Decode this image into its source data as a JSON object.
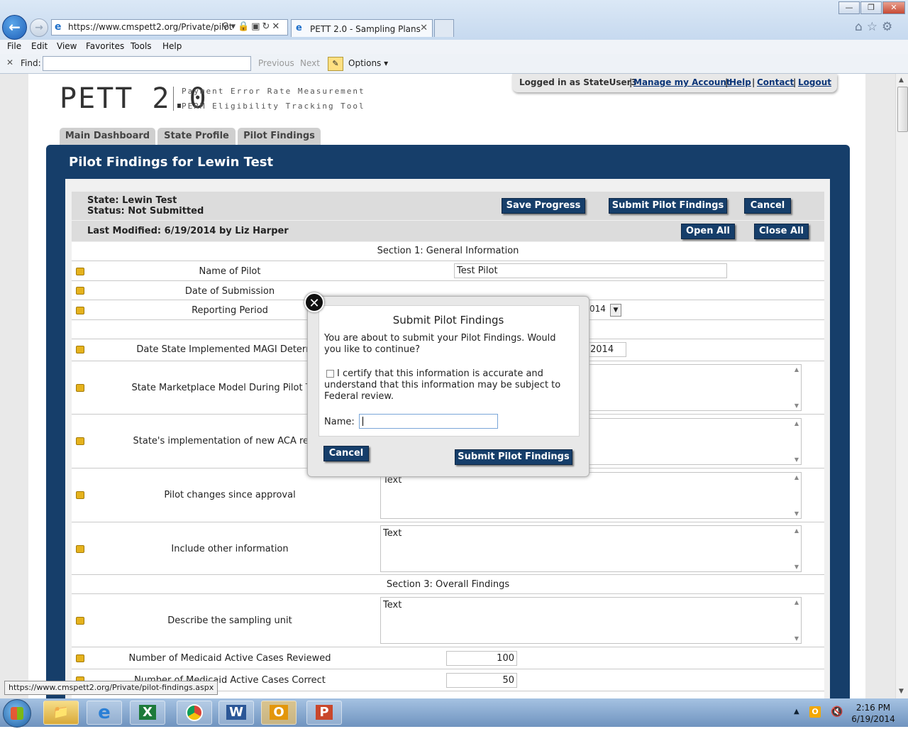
{
  "browser": {
    "url": "https://www.cmspett2.org/Private/pilot",
    "tab_title": "PETT 2.0 - Sampling Plans",
    "menu": [
      "File",
      "Edit",
      "View",
      "Favorites",
      "Tools",
      "Help"
    ],
    "find_label": "Find:",
    "find_prev": "Previous",
    "find_next": "Next",
    "find_options": "Options",
    "status_url": "https://www.cmspett2.org/Private/pilot-findings.aspx"
  },
  "header": {
    "logo": "PETT 2.0",
    "tagline1": "Payment Error Rate Measurement",
    "tagline2": "PERM Eligibility Tracking Tool",
    "logged_in": "Logged in as StateUser3",
    "links": [
      "Manage my Account",
      "Help",
      "Contact",
      "Logout"
    ]
  },
  "tabs": [
    "Main Dashboard",
    "State Profile",
    "Pilot Findings"
  ],
  "panel": {
    "title": "Pilot Findings for Lewin Test",
    "state": "State: Lewin Test",
    "status": "Status: Not Submitted",
    "last_modified": "Last Modified: 6/19/2014 by Liz Harper",
    "buttons": {
      "save": "Save Progress",
      "submit": "Submit Pilot Findings",
      "cancel": "Cancel",
      "open_all": "Open All",
      "close_all": "Close All"
    }
  },
  "form": {
    "section1": "Section 1: General Information",
    "section3": "Section 3: Overall Findings",
    "rows": {
      "name_of_pilot": {
        "label": "Name of Pilot",
        "value": "Test Pilot"
      },
      "date_submission": {
        "label": "Date of Submission"
      },
      "reporting_period": {
        "label": "Reporting Period",
        "value": "014"
      },
      "date_magi": {
        "label": "Date State Implemented MAGI Determin",
        "value": "2014"
      },
      "marketplace": {
        "label": "State Marketplace Model During Pilot Time"
      },
      "aca": {
        "label": "State's implementation of new ACA requir"
      },
      "pilot_changes": {
        "label": "Pilot changes since approval",
        "value": "Text"
      },
      "other_info": {
        "label": "Include other information",
        "value": "Text"
      },
      "sampling_unit": {
        "label": "Describe the sampling unit",
        "value": "Text"
      },
      "cases_reviewed": {
        "label": "Number of Medicaid Active Cases Reviewed",
        "value": "100"
      },
      "cases_correct": {
        "label": "Number of Medicaid Active Cases Correct",
        "value": "50"
      }
    }
  },
  "modal": {
    "title": "Submit Pilot Findings",
    "message": "You are about to submit your Pilot Findings. Would you like to continue?",
    "certify": "I certify that this information is accurate and understand that this information may be subject to Federal review.",
    "name_label": "Name:",
    "name_value": "",
    "cancel": "Cancel",
    "submit": "Submit Pilot Findings"
  },
  "taskbar": {
    "apps": [
      "ie-icon",
      "excel-icon",
      "chrome-icon",
      "word-icon",
      "outlook-icon",
      "powerpoint-icon"
    ],
    "time": "2:16 PM",
    "date": "6/19/2014"
  }
}
